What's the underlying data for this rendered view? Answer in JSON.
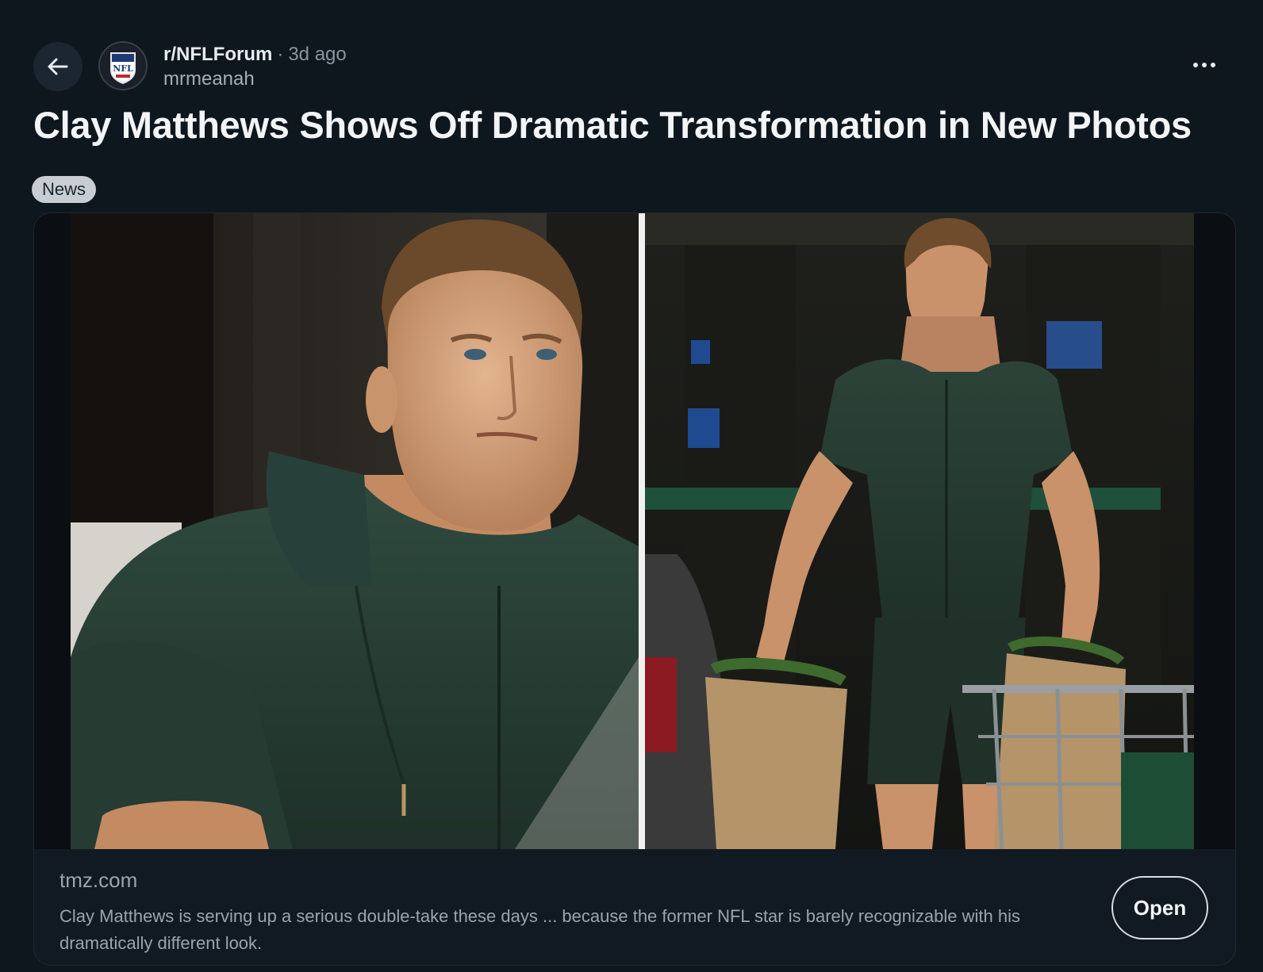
{
  "header": {
    "subreddit": "r/NFLForum",
    "separator": "·",
    "age": "3d ago",
    "username": "mrmeanah",
    "avatar_text": "NFL"
  },
  "post": {
    "title": "Clay Matthews Shows Off Dramatic Transformation in New Photos",
    "flair": "News"
  },
  "link_card": {
    "domain": "tmz.com",
    "description": "Clay Matthews is serving up a serious double-take these days ... because the former NFL star is barely recognizable with his dramatically different look.",
    "open_label": "Open"
  },
  "icons": {
    "back": "arrow-left-icon",
    "more": "more-horizontal-icon"
  },
  "colors": {
    "background": "#0e161e",
    "card": "#111a23",
    "flair_bg": "#c7cdd2",
    "hoodie_green": "#2a3d34"
  }
}
